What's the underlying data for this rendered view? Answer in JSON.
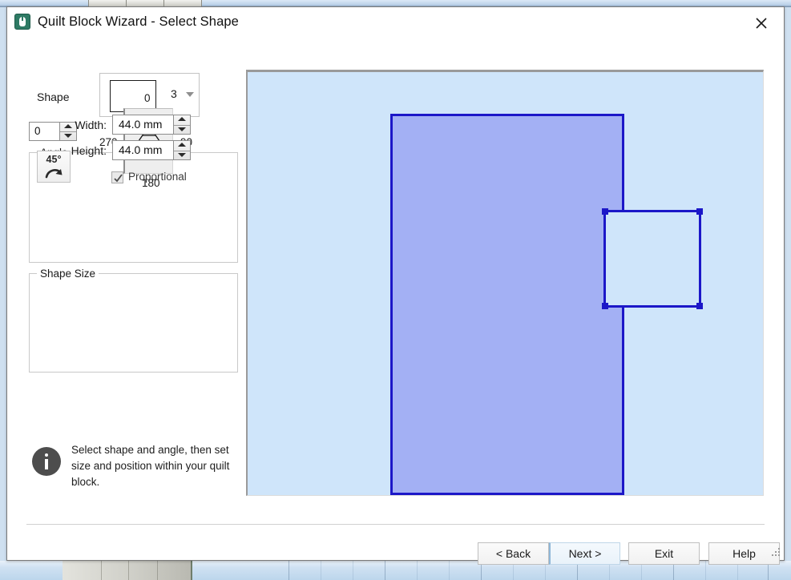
{
  "window": {
    "title": "Quilt Block Wizard - Select Shape",
    "app_icon": "quilt-app-icon",
    "close_icon": "close-icon"
  },
  "shape": {
    "label": "Shape",
    "value": "3",
    "preview_icon": "square-shape-preview",
    "dropdown_icon": "chevron-down-icon"
  },
  "angle": {
    "group_title": "Angle",
    "value": "0",
    "rotate_button_label": "45°",
    "rotate_icon": "rotate-clockwise-icon",
    "dial_icon": "pyramid-orientation-icon",
    "dial_labels": {
      "top": "0",
      "right": "90",
      "bottom": "180",
      "left": "270"
    },
    "spinner_up_icon": "spinner-up-icon",
    "spinner_down_icon": "spinner-down-icon"
  },
  "shape_size": {
    "group_title": "Shape Size",
    "width_label": "Width:",
    "width_value": "44.0 mm",
    "height_label": "Height:",
    "height_value": "44.0 mm",
    "proportional_label": "Proportional",
    "proportional_checked": true,
    "check_icon": "checkmark-icon"
  },
  "info": {
    "icon": "info-icon",
    "text": "Select shape and angle, then set size and position within your quilt block."
  },
  "preview": {
    "canvas_background": "#cfe5fa",
    "block_fill": "#a3b0f4",
    "block_outline": "#1c17c8",
    "shape_fill": "#cfe5fa",
    "shape_outline": "#1c17c8",
    "handle_color": "#1c17c8"
  },
  "footer": {
    "back_label": "< Back",
    "next_label": "Next >",
    "exit_label": "Exit",
    "help_label": "Help"
  }
}
